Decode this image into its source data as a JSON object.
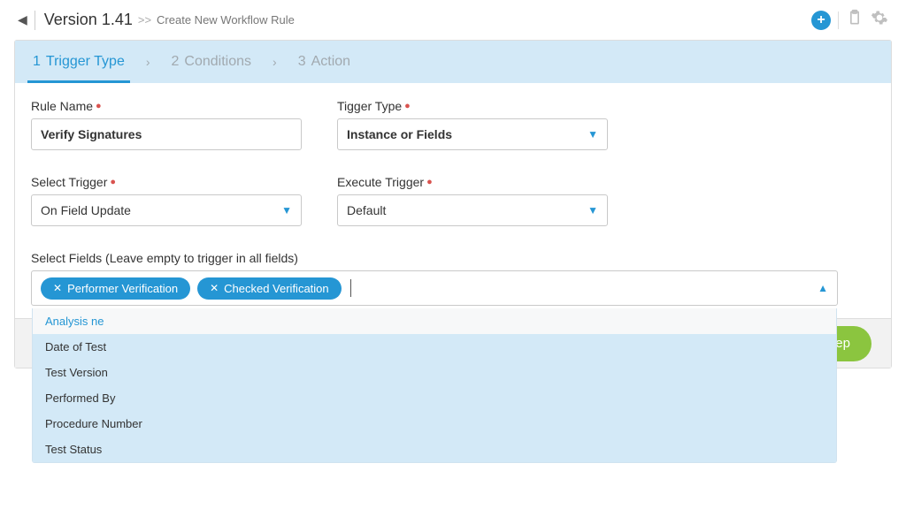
{
  "header": {
    "version": "Version 1.41",
    "breadcrumb_sep": ">>",
    "breadcrumb": "Create New Workflow Rule"
  },
  "steps": {
    "step1_num": "1",
    "step1_label": "Trigger Type",
    "step2_num": "2",
    "step2_label": "Conditions",
    "step3_num": "3",
    "step3_label": "Action",
    "sep": "›"
  },
  "form": {
    "rule_name_label": "Rule Name",
    "rule_name_value": "Verify Signatures",
    "trigger_type_label": "Tigger Type",
    "trigger_type_value": "Instance or Fields",
    "select_trigger_label": "Select Trigger",
    "select_trigger_value": "On Field Update",
    "execute_trigger_label": "Execute Trigger",
    "execute_trigger_value": "Default",
    "select_fields_label": "Select Fields (Leave empty to trigger in all fields)",
    "chip1": "Performer Verification",
    "chip2": "Checked Verification",
    "options": [
      "Analysis ne",
      "Date of Test",
      "Test Version",
      "Performed By",
      "Procedure Number",
      "Test Status"
    ]
  },
  "footer": {
    "next": "step"
  }
}
